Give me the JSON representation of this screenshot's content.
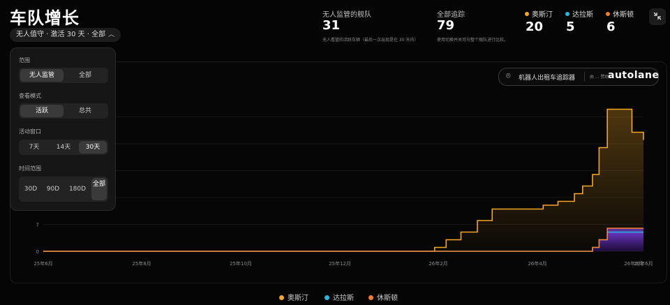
{
  "header": {
    "title": "车队增长",
    "filter_label": "无人值守 · 激活 30 天 · 全部"
  },
  "stats": {
    "unsupervised": {
      "label": "无人监管的舰队",
      "value": "31",
      "note": "无人看管的活跃车辆（最后一次出现是在 30 天内）"
    },
    "all_tracked": {
      "label": "全部追踪",
      "value": "79",
      "note": "使用切换并关可与整个舰队进行比较。"
    }
  },
  "cities": [
    {
      "name": "奥斯汀",
      "value": "20",
      "color": "#f5a623"
    },
    {
      "name": "达拉斯",
      "value": "5",
      "color": "#29b6e0"
    },
    {
      "name": "休斯顿",
      "value": "6",
      "color": "#f57c2a"
    }
  ],
  "panel": {
    "scope_label": "范围",
    "scope_options": [
      "无人监管",
      "全部"
    ],
    "view_label": "查看模式",
    "view_options": [
      "活跃",
      "总共"
    ],
    "window_label": "活动窗口",
    "window_options": [
      "7天",
      "14天",
      "30天"
    ],
    "range_label": "时间范围",
    "range_options": [
      "30D",
      "90D",
      "180D",
      "全部"
    ]
  },
  "badge": {
    "tracker": "机器人出租车追踪器",
    "sponsor": "由 ... 赞助",
    "brand": "autolane"
  },
  "chart_data": {
    "type": "area",
    "title": "",
    "xlabel": "",
    "ylabel": "",
    "x_ticks": [
      "25年6月",
      "25年8月",
      "25年10月",
      "25年12月",
      "26年2月",
      "26年4月",
      "26年6月",
      "25年6月"
    ],
    "y_ticks": [
      "0",
      "7"
    ],
    "ylim": [
      0,
      40
    ],
    "x": [
      "2025-06-01",
      "2026-01-15",
      "2026-01-25",
      "2026-02-01",
      "2026-02-10",
      "2026-02-20",
      "2026-03-01",
      "2026-03-15",
      "2026-03-25",
      "2026-04-01",
      "2026-04-10",
      "2026-04-20",
      "2026-04-25",
      "2026-05-01",
      "2026-05-05",
      "2026-05-10",
      "2026-05-20",
      "2026-05-25",
      "2026-06-01"
    ],
    "series": [
      {
        "name": "奥斯汀",
        "color": "#f5a623",
        "values": [
          0,
          0,
          1,
          3,
          5,
          8,
          11,
          11,
          11,
          12,
          13,
          15,
          17,
          20,
          27,
          37,
          37,
          31,
          29
        ]
      },
      {
        "name": "达拉斯",
        "color": "#29b6e0",
        "values": [
          0,
          0,
          0,
          0,
          0,
          0,
          0,
          0,
          0,
          0,
          0,
          0,
          0,
          1,
          3,
          5,
          5,
          5,
          5
        ]
      },
      {
        "name": "休斯顿",
        "color": "#f57c2a",
        "values": [
          0,
          0,
          0,
          0,
          0,
          0,
          0,
          0,
          0,
          0,
          0,
          0,
          0,
          1,
          3,
          6,
          6,
          6,
          6
        ]
      }
    ],
    "legend": "bottom"
  },
  "legend": [
    {
      "name": "奥斯汀",
      "color": "#f5a623"
    },
    {
      "name": "达拉斯",
      "color": "#29b6e0"
    },
    {
      "name": "休斯顿",
      "color": "#f57c2a"
    }
  ]
}
